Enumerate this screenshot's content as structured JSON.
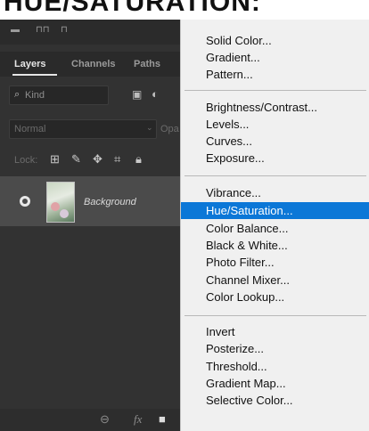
{
  "top_title": "HUE/SATURATION:",
  "tabs": [
    "Layers",
    "Channels",
    "Paths"
  ],
  "filter": {
    "kind": "Kind"
  },
  "blend": {
    "mode": "Normal",
    "opacity_label": "Opa"
  },
  "lock": {
    "label": "Lock:"
  },
  "layer": {
    "name": "Background"
  },
  "bottom_bar": {
    "fx": "fx"
  },
  "menu": {
    "groups": [
      [
        "Solid Color...",
        "Gradient...",
        "Pattern..."
      ],
      [
        "Brightness/Contrast...",
        "Levels...",
        "Curves...",
        "Exposure..."
      ],
      [
        "Vibrance...",
        "Hue/Saturation...",
        "Color Balance...",
        "Black & White...",
        "Photo Filter...",
        "Channel Mixer...",
        "Color Lookup..."
      ],
      [
        "Invert",
        "Posterize...",
        "Threshold...",
        "Gradient Map...",
        "Selective Color..."
      ]
    ],
    "highlighted": "Hue/Saturation..."
  }
}
